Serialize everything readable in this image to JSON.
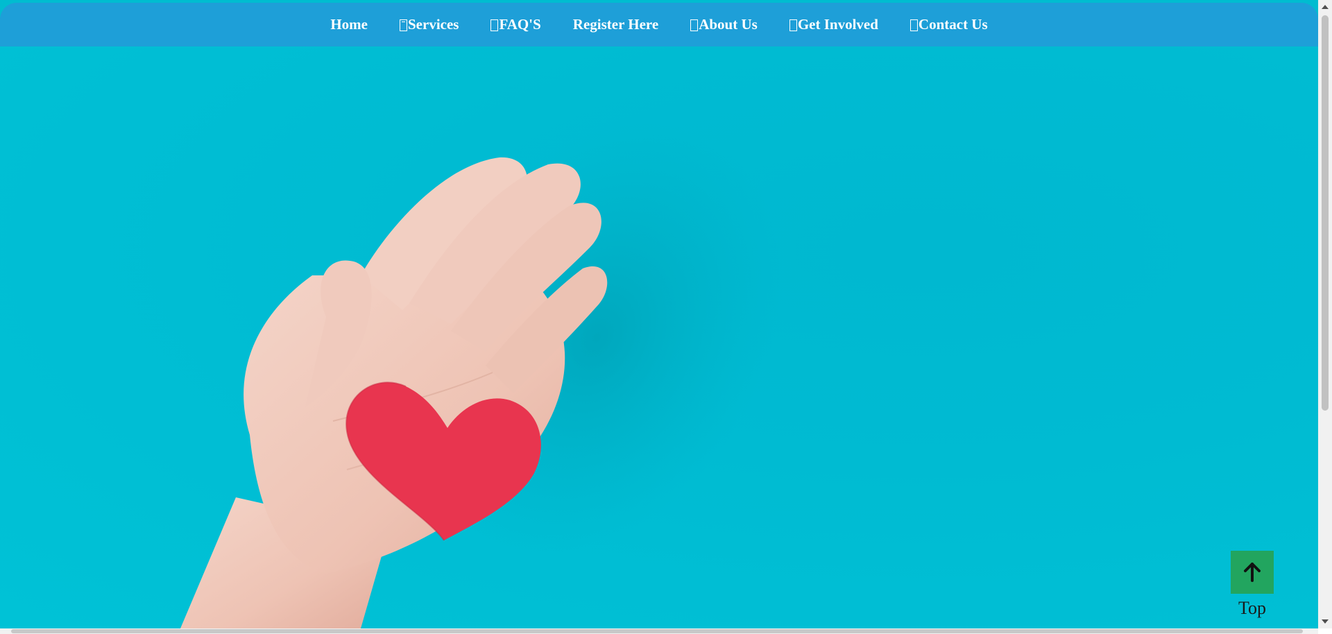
{
  "nav": {
    "items": [
      {
        "label": "Home",
        "icon": ""
      },
      {
        "label": "Services",
        "icon": "services-icon"
      },
      {
        "label": "FAQ'S",
        "icon": "faq-icon"
      },
      {
        "label": "Register Here",
        "icon": ""
      },
      {
        "label": "About Us",
        "icon": "about-icon"
      },
      {
        "label": "Get Involved",
        "icon": "involved-icon"
      },
      {
        "label": "Contact Us",
        "icon": "contact-icon"
      }
    ]
  },
  "hero": {
    "image": "hand-holding-red-heart",
    "background_color": "#00bcd0",
    "heart_color": "#e8354f"
  },
  "top_button": {
    "label": "Top",
    "icon": "arrow-up-icon",
    "color": "#22a55f"
  },
  "colors": {
    "navbar": "#1e9fd8",
    "nav_text": "#ffffff"
  }
}
